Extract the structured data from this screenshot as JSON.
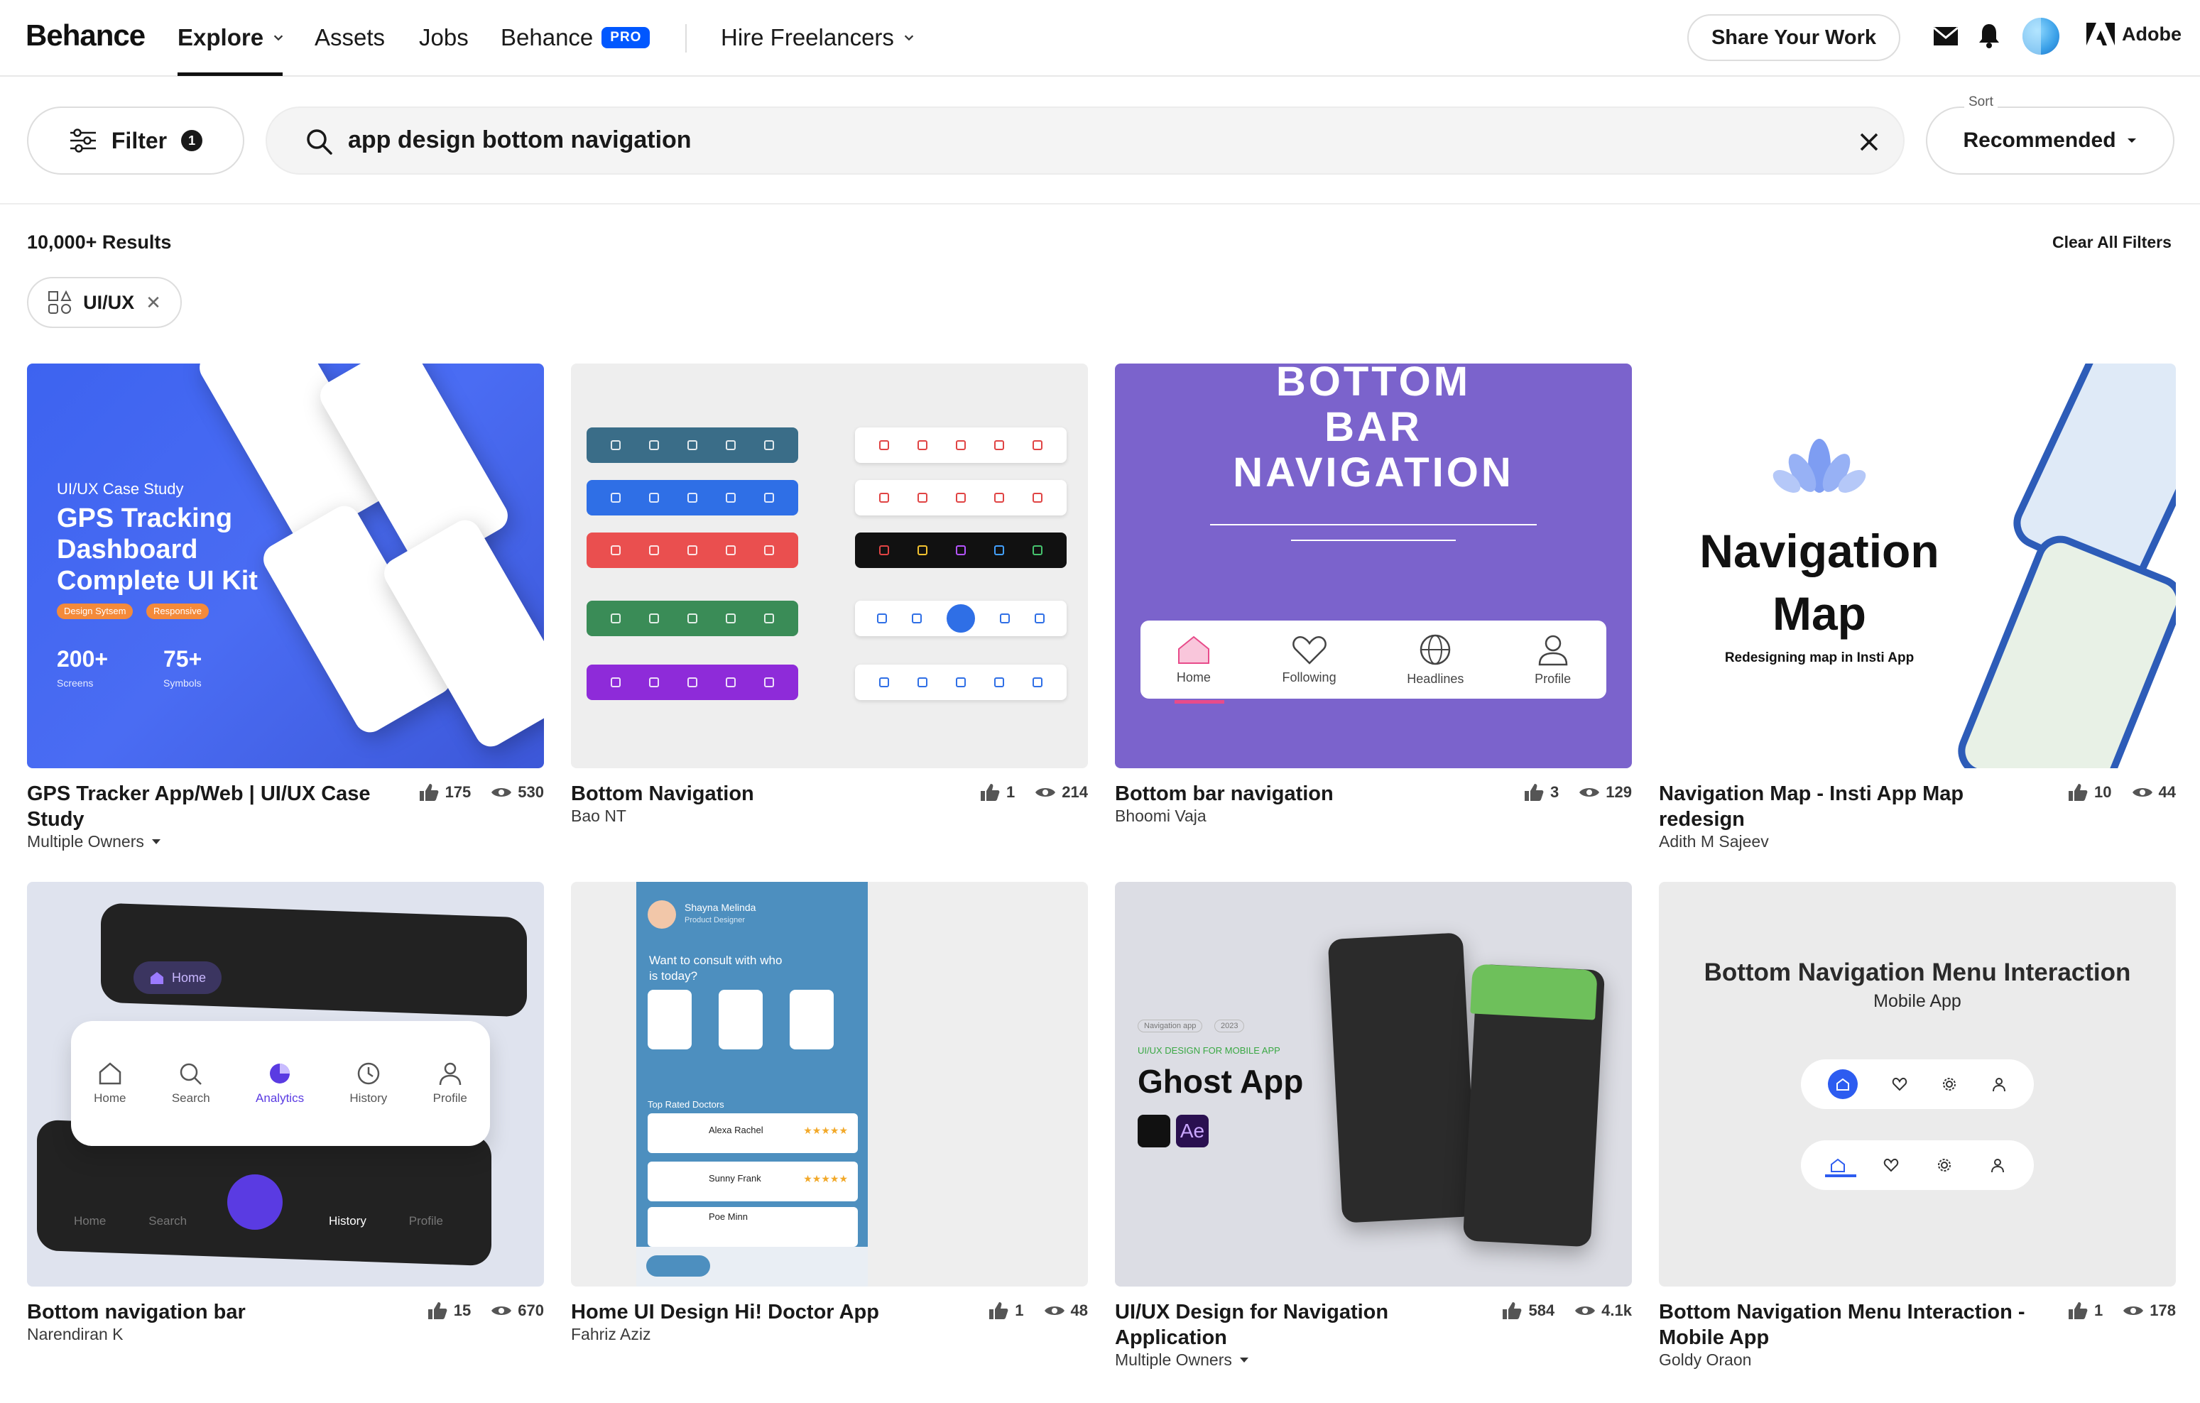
{
  "header": {
    "logo": "Behance",
    "nav": {
      "explore": "Explore",
      "assets": "Assets",
      "jobs": "Jobs",
      "behance": "Behance",
      "pro_badge": "PRO",
      "hire": "Hire Freelancers"
    },
    "share_button": "Share Your Work",
    "adobe": "Adobe"
  },
  "search": {
    "filter_label": "Filter",
    "filter_count": "1",
    "query": "app design bottom navigation",
    "sort_label": "Sort",
    "sort_value": "Recommended"
  },
  "results": {
    "count": "10,000+ Results",
    "clear_filters": "Clear All Filters",
    "chips": [
      {
        "label": "UI/UX"
      }
    ]
  },
  "cards": [
    {
      "title": "GPS Tracker App/Web | UI/UX Case Study",
      "owner": "Multiple Owners",
      "likes": "175",
      "views": "530",
      "thumb": {
        "case_label": "UI/UX Case Study",
        "headline": "GPS Tracking Dashboard Complete UI Kit",
        "tag1": "Design Sytsem",
        "tag2": "Responsive",
        "stat1_value": "200+",
        "stat1_label": "Screens",
        "stat2_value": "75+",
        "stat2_label": "Symbols"
      }
    },
    {
      "title": "Bottom Navigation",
      "owner": "Bao NT",
      "likes": "1",
      "views": "214"
    },
    {
      "title": "Bottom bar navigation",
      "owner": "Bhoomi Vaja",
      "likes": "3",
      "views": "129",
      "thumb": {
        "line1": "BOTTOM",
        "line2": "BAR",
        "line3": "NAVIGATION",
        "tabs": [
          "Home",
          "Following",
          "Headlines",
          "Profile"
        ]
      }
    },
    {
      "title": "Navigation Map - Insti App Map redesign",
      "owner": "Adith M Sajeev",
      "likes": "10",
      "views": "44",
      "thumb": {
        "headline": "Navigation Map",
        "sub": "Redesigning map in Insti App"
      }
    },
    {
      "title": "Bottom navigation bar",
      "owner": "Narendiran K",
      "likes": "15",
      "views": "670",
      "thumb": {
        "top_active": "Home",
        "tabs": [
          "Home",
          "Search",
          "Analytics",
          "History",
          "Profile"
        ],
        "bottom_tabs": [
          "Home",
          "Search",
          "History",
          "Profile"
        ]
      }
    },
    {
      "title": "Home UI Design Hi! Doctor App",
      "owner": "Fahriz Aziz",
      "likes": "1",
      "views": "48",
      "thumb": {
        "user": "Shayna Melinda",
        "role": "Product Designer",
        "prompt": "Want to consult with who is today?",
        "section": "Top Rated Doctors",
        "doctors": [
          "Alexa Rachel",
          "Sunny Frank",
          "Poe Minn"
        ]
      }
    },
    {
      "title": "UI/UX Design for Navigation Application",
      "owner": "Multiple Owners",
      "likes": "584",
      "views": "4.1k",
      "thumb": {
        "kicker": "UI/UX DESIGN FOR MOBILE APP",
        "headline": "Ghost App",
        "tag1": "Navigation app",
        "tag2": "2023",
        "ae": "Ae"
      }
    },
    {
      "title": "Bottom Navigation Menu Interaction - Mobile App",
      "owner": "Goldy Oraon",
      "likes": "1",
      "views": "178",
      "thumb": {
        "headline": "Bottom Navigation Menu Interaction",
        "sub": "Mobile App"
      }
    }
  ],
  "colors": {
    "accent_blue": "#0057ff",
    "card1_bg": "#4a6cf3",
    "card3_bg": "#7b63cc"
  }
}
